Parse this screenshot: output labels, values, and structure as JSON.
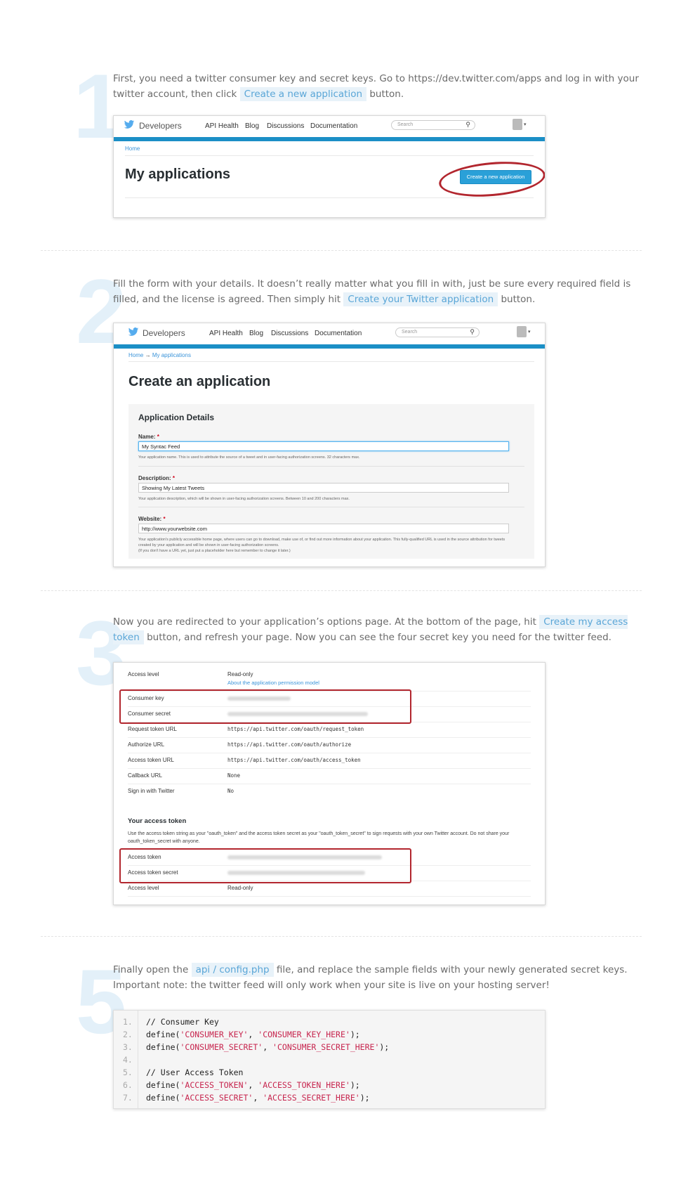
{
  "steps": [
    {
      "number": "1",
      "text_before": "First, you need a twitter consumer key and secret keys. Go to https://dev.twitter.com/apps and log in with your twitter account, then click",
      "highlight": "Create a new application",
      "text_after": "button."
    },
    {
      "number": "2",
      "text_before": "Fill the form with your details. It doesn’t really matter what you fill in with, just be sure every required field is filled, and the license is agreed.  Then simply hit",
      "highlight": "Create your Twitter application",
      "text_after": "button."
    },
    {
      "number": "3",
      "text_before": "Now you are redirected to your application’s options page. At the bottom of the page, hit",
      "highlight": "Create my access token",
      "text_after": "button, and refresh your page. Now you can see the four secret key you need for the twitter feed."
    },
    {
      "number": "5",
      "text_before": "Finally open the",
      "highlight": "api / config.php",
      "text_after": "file, and replace the sample fields with your newly generated secret keys. Important note: the twitter feed will only work when your site is live on your hosting server!"
    }
  ],
  "twitter_header": {
    "brand": "Developers",
    "nav": [
      "API Health",
      "Blog",
      "Discussions",
      "Documentation"
    ],
    "search_placeholder": "Search",
    "search_icon": "magnifier-icon",
    "avatar_icon": "user-avatar-icon"
  },
  "shot1": {
    "breadcrumb": "Home",
    "title": "My applications",
    "button": "Create a new application"
  },
  "shot2": {
    "breadcrumb_home": "Home",
    "breadcrumb_arrow": "→",
    "breadcrumb_current": "My applications",
    "title": "Create an application",
    "section_title": "Application Details",
    "fields": [
      {
        "label": "Name:",
        "required": "*",
        "value": "My Syntac Feed",
        "help": "Your application name. This is used to attribute the source of a tweet and in user-facing authorization screens. 32 characters max."
      },
      {
        "label": "Description:",
        "required": "*",
        "value": "Showing My Latest Tweets",
        "help": "Your application description, which will be shown in user-facing authorization screens. Between 10 and 200 characters max."
      },
      {
        "label": "Website:",
        "required": "*",
        "value": "http://www.yourwebsite.com",
        "help": "Your application's publicly accessible home page, where users can go to download, make use of, or find out more information about your application. This fully-qualified URL is used in the source attribution for tweets created by your application and will be shown in user-facing authorization screens.",
        "help2": "(If you don't have a URL yet, just put a placeholder here but remember to change it later.)"
      }
    ]
  },
  "shot3": {
    "rows": [
      {
        "label": "Access level",
        "value": "Read-only",
        "link": "About the application permission model"
      },
      {
        "label": "Consumer key",
        "value": ""
      },
      {
        "label": "Consumer secret",
        "value": ""
      },
      {
        "label": "Request token URL",
        "value": "https://api.twitter.com/oauth/request_token"
      },
      {
        "label": "Authorize URL",
        "value": "https://api.twitter.com/oauth/authorize"
      },
      {
        "label": "Access token URL",
        "value": "https://api.twitter.com/oauth/access_token"
      },
      {
        "label": "Callback URL",
        "value": "None"
      },
      {
        "label": "Sign in with Twitter",
        "value": "No"
      }
    ],
    "token_title": "Your access token",
    "token_desc": "Use the access token string as your \"oauth_token\" and the access token secret as your \"oauth_token_secret\" to sign requests with your own Twitter account. Do not share your oauth_token_secret with anyone.",
    "token_rows": [
      {
        "label": "Access token",
        "value": ""
      },
      {
        "label": "Access token secret",
        "value": ""
      },
      {
        "label": "Access level",
        "value": "Read-only"
      }
    ]
  },
  "code": {
    "lines": [
      {
        "n": "1.",
        "kind": "comment",
        "text": "// Consumer Key"
      },
      {
        "n": "2.",
        "kind": "define",
        "fn": "define",
        "a": "'CONSUMER_KEY'",
        "b": "'CONSUMER_KEY_HERE'"
      },
      {
        "n": "3.",
        "kind": "define",
        "fn": "define",
        "a": "'CONSUMER_SECRET'",
        "b": "'CONSUMER_SECRET_HERE'"
      },
      {
        "n": "4.",
        "kind": "blank",
        "text": ""
      },
      {
        "n": "5.",
        "kind": "comment",
        "text": "// User Access Token"
      },
      {
        "n": "6.",
        "kind": "define",
        "fn": "define",
        "a": "'ACCESS_TOKEN'",
        "b": "'ACCESS_TOKEN_HERE'"
      },
      {
        "n": "7.",
        "kind": "define",
        "fn": "define",
        "a": "'ACCESS_SECRET'",
        "b": "'ACCESS_SECRET_HERE'"
      }
    ]
  },
  "colors": {
    "accent": "#5aa6d7",
    "highlight_bg": "#e8f2f9",
    "twitter_bar": "#1b8fc6",
    "annotation_red": "#b2262e",
    "code_string": "#c7254e"
  }
}
